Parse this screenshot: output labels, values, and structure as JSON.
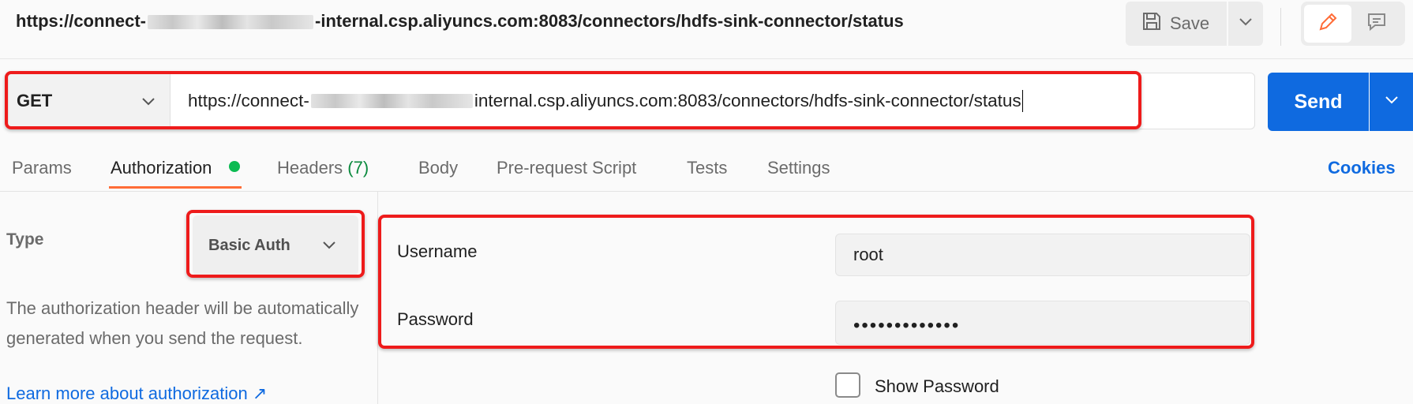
{
  "title": {
    "prefix": "https://connect-",
    "suffix": "-internal.csp.aliyuncs.com:8083/connectors/hdfs-sink-connector/status"
  },
  "toolbar": {
    "save_label": "Save"
  },
  "request": {
    "method": "GET",
    "url_prefix": "https://connect-",
    "url_suffix": "internal.csp.aliyuncs.com:8083/connectors/hdfs-sink-connector/status",
    "send_label": "Send"
  },
  "tabs": [
    {
      "label": "Params"
    },
    {
      "label": "Authorization"
    },
    {
      "label": "Headers",
      "count": "(7)"
    },
    {
      "label": "Body"
    },
    {
      "label": "Pre-request Script"
    },
    {
      "label": "Tests"
    },
    {
      "label": "Settings"
    }
  ],
  "cookies_label": "Cookies",
  "auth": {
    "type_label": "Type",
    "type_value": "Basic Auth",
    "help_text": "The authorization header will be automatically generated when you send the request.",
    "learn_more": "Learn more about authorization ↗",
    "username_label": "Username",
    "username_value": "root",
    "password_label": "Password",
    "password_value": "•••••••••••••",
    "show_password_label": "Show Password",
    "show_password_checked": false
  },
  "colors": {
    "accent_send": "#0f6ae0",
    "tab_active": "#ff6c37",
    "highlight": "#ee1b1b",
    "auth_dot": "#0cbb52"
  }
}
